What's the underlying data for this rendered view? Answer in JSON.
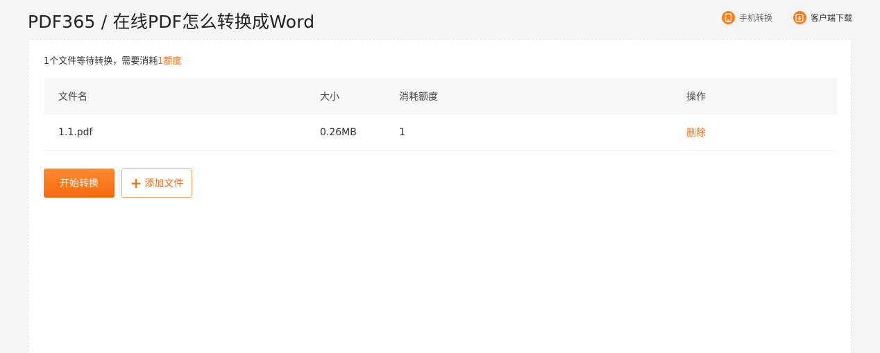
{
  "header": {
    "title": "PDF365 / 在线PDF怎么转换成Word",
    "links": [
      {
        "label": "手机转换",
        "icon": "mobile-icon"
      },
      {
        "label": "客户端下载",
        "icon": "download-icon"
      }
    ]
  },
  "summary": {
    "prefix": "1个文件等待转换，需要消耗",
    "amount": "1额度"
  },
  "table": {
    "columns": [
      "文件名",
      "大小",
      "消耗额度",
      "操作"
    ],
    "rows": [
      {
        "name": "1.1.pdf",
        "size": "0.26MB",
        "cost": "1",
        "action": "删除"
      }
    ]
  },
  "buttons": {
    "start": "开始转换",
    "add": "添加文件"
  },
  "colors": {
    "accent": "#fa6f14",
    "background": "#f5f5f5"
  }
}
